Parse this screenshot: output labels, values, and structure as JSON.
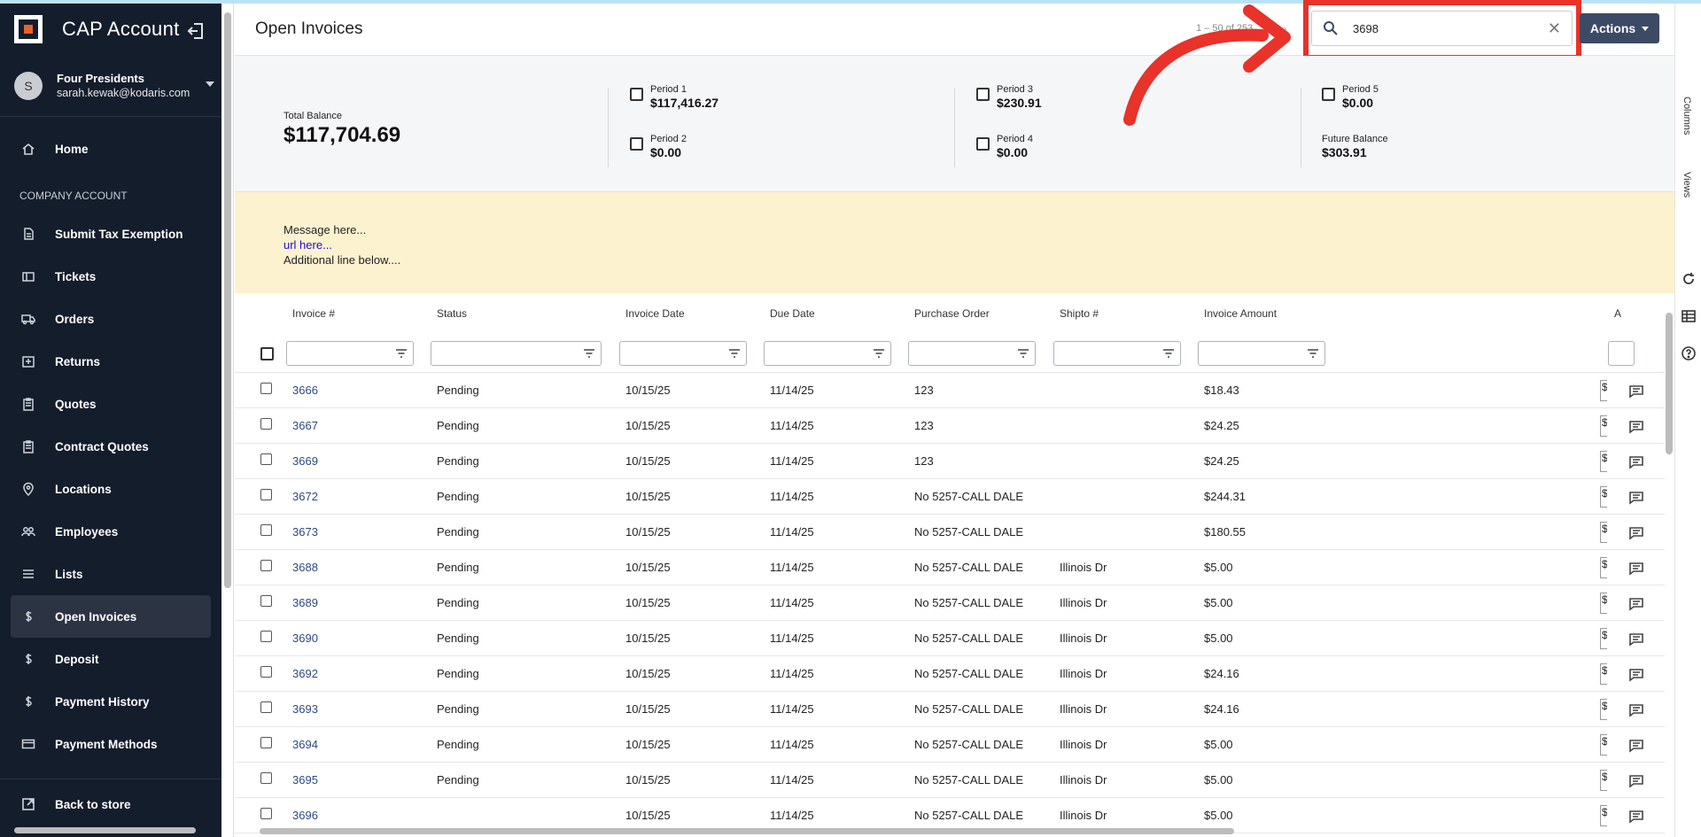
{
  "app": {
    "title": "CAP Account"
  },
  "user": {
    "initial": "S",
    "name": "Four Presidents",
    "email": "sarah.kewak@kodaris.com"
  },
  "nav": {
    "home": "Home",
    "section_label": "COMPANY ACCOUNT",
    "items": [
      {
        "label": "Submit Tax Exemption",
        "icon": "document-icon"
      },
      {
        "label": "Tickets",
        "icon": "ticket-icon"
      },
      {
        "label": "Orders",
        "icon": "truck-icon"
      },
      {
        "label": "Returns",
        "icon": "return-icon"
      },
      {
        "label": "Quotes",
        "icon": "clipboard-icon"
      },
      {
        "label": "Contract Quotes",
        "icon": "clipboard-icon"
      },
      {
        "label": "Locations",
        "icon": "location-icon"
      },
      {
        "label": "Employees",
        "icon": "people-icon"
      },
      {
        "label": "Lists",
        "icon": "list-icon"
      },
      {
        "label": "Open Invoices",
        "icon": "dollar-icon",
        "active": true
      },
      {
        "label": "Deposit",
        "icon": "dollar-icon"
      },
      {
        "label": "Payment History",
        "icon": "dollar-icon"
      },
      {
        "label": "Payment Methods",
        "icon": "card-icon"
      }
    ],
    "back": "Back to store"
  },
  "header": {
    "title": "Open Invoices",
    "pager": "1 – 50 of 253",
    "search_value": "3698",
    "actions_label": "Actions"
  },
  "summary": {
    "total_label": "Total Balance",
    "total_value": "$117,704.69",
    "p1_label": "Period 1",
    "p1_value": "$117,416.27",
    "p2_label": "Period 2",
    "p2_value": "$0.00",
    "p3_label": "Period 3",
    "p3_value": "$230.91",
    "p4_label": "Period 4",
    "p4_value": "$0.00",
    "p5_label": "Period 5",
    "p5_value": "$0.00",
    "future_label": "Future Balance",
    "future_value": "$303.91"
  },
  "message": {
    "line1": "Message here...",
    "link": "url here...",
    "line3": "Additional line below...."
  },
  "rail": {
    "columns": "Columns",
    "views": "Views"
  },
  "table": {
    "columns": [
      "Invoice #",
      "Status",
      "Invoice Date",
      "Due Date",
      "Purchase Order",
      "Shipto #",
      "Invoice Amount",
      "A"
    ],
    "rows": [
      {
        "inv": "3666",
        "status": "Pending",
        "date": "10/15/25",
        "due": "11/14/25",
        "po": "123",
        "shipto": "",
        "amount": "$18.43"
      },
      {
        "inv": "3667",
        "status": "Pending",
        "date": "10/15/25",
        "due": "11/14/25",
        "po": "123",
        "shipto": "",
        "amount": "$24.25"
      },
      {
        "inv": "3669",
        "status": "Pending",
        "date": "10/15/25",
        "due": "11/14/25",
        "po": "123",
        "shipto": "",
        "amount": "$24.25"
      },
      {
        "inv": "3672",
        "status": "Pending",
        "date": "10/15/25",
        "due": "11/14/25",
        "po": "No 5257-CALL DALE",
        "shipto": "",
        "amount": "$244.31"
      },
      {
        "inv": "3673",
        "status": "Pending",
        "date": "10/15/25",
        "due": "11/14/25",
        "po": "No 5257-CALL DALE",
        "shipto": "",
        "amount": "$180.55"
      },
      {
        "inv": "3688",
        "status": "Pending",
        "date": "10/15/25",
        "due": "11/14/25",
        "po": "No 5257-CALL DALE",
        "shipto": "Illinois Dr",
        "amount": "$5.00"
      },
      {
        "inv": "3689",
        "status": "Pending",
        "date": "10/15/25",
        "due": "11/14/25",
        "po": "No 5257-CALL DALE",
        "shipto": "Illinois Dr",
        "amount": "$5.00"
      },
      {
        "inv": "3690",
        "status": "Pending",
        "date": "10/15/25",
        "due": "11/14/25",
        "po": "No 5257-CALL DALE",
        "shipto": "Illinois Dr",
        "amount": "$5.00"
      },
      {
        "inv": "3692",
        "status": "Pending",
        "date": "10/15/25",
        "due": "11/14/25",
        "po": "No 5257-CALL DALE",
        "shipto": "Illinois Dr",
        "amount": "$24.16"
      },
      {
        "inv": "3693",
        "status": "Pending",
        "date": "10/15/25",
        "due": "11/14/25",
        "po": "No 5257-CALL DALE",
        "shipto": "Illinois Dr",
        "amount": "$24.16"
      },
      {
        "inv": "3694",
        "status": "Pending",
        "date": "10/15/25",
        "due": "11/14/25",
        "po": "No 5257-CALL DALE",
        "shipto": "Illinois Dr",
        "amount": "$5.00"
      },
      {
        "inv": "3695",
        "status": "Pending",
        "date": "10/15/25",
        "due": "11/14/25",
        "po": "No 5257-CALL DALE",
        "shipto": "Illinois Dr",
        "amount": "$5.00"
      },
      {
        "inv": "3696",
        "status": "",
        "date": "10/15/25",
        "due": "11/14/25",
        "po": "No 5257-CALL DALE",
        "shipto": "Illinois Dr",
        "amount": "$5.00"
      }
    ]
  },
  "colors": {
    "sidebar_bg": "#141d2b",
    "accent": "#3d4a66",
    "highlight": "#e8322a",
    "message_bg": "#fdf2cf"
  }
}
